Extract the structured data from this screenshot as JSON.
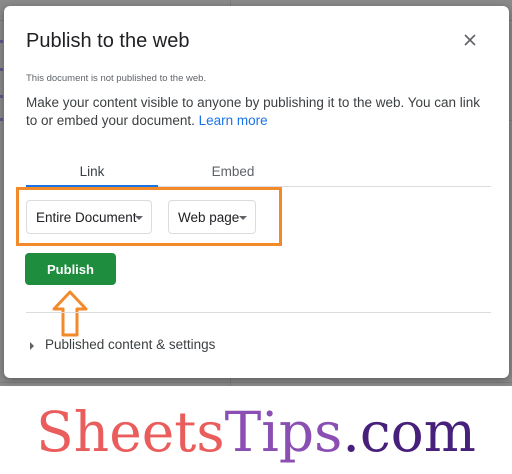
{
  "dialog": {
    "title": "Publish to the web",
    "close_icon": "close-icon",
    "status": "This document is not published to the web.",
    "description": "Make your content visible to anyone by publishing it to the web. You can link to or embed your document.",
    "learn_more": "Learn more",
    "tabs": [
      {
        "label": "Link",
        "selected": true
      },
      {
        "label": "Embed",
        "selected": false
      }
    ],
    "scope_dropdown": {
      "value": "Entire Document"
    },
    "format_dropdown": {
      "value": "Web page"
    },
    "publish_label": "Publish",
    "settings_label": "Published content & settings"
  },
  "watermark": {
    "part1": "Sheets",
    "part2": "Tips",
    "part3": ".com"
  },
  "colors": {
    "accent_blue": "#1a73e8",
    "publish_green": "#1e8e3e",
    "annotation_orange": "#f28a2b",
    "brand_red": "#ea5d5d",
    "brand_purple": "#8b4fb3",
    "brand_dark_purple": "#46207a"
  },
  "icons": [
    "close-icon",
    "caret-down-icon",
    "up-arrow-annotation-icon",
    "expand-triangle-icon"
  ]
}
